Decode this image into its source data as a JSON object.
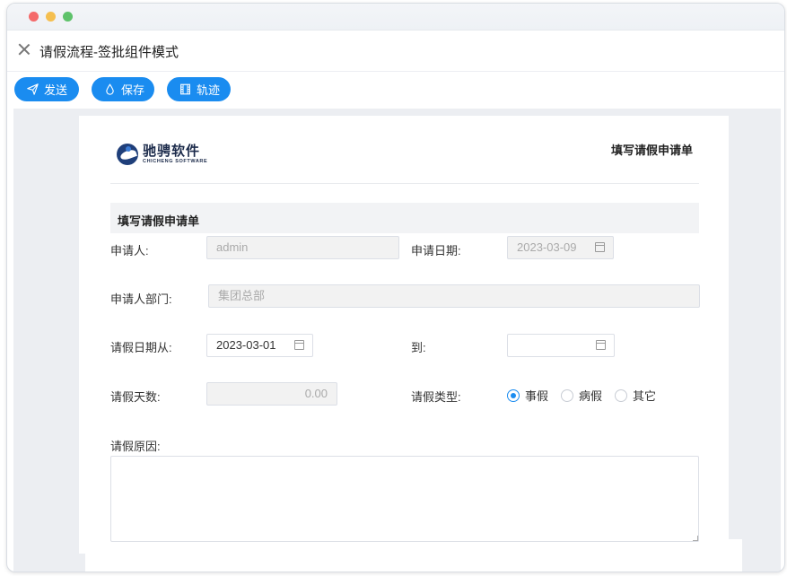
{
  "window": {
    "controls": [
      "close",
      "minimize",
      "maximize"
    ]
  },
  "header": {
    "title": "请假流程-签批组件模式"
  },
  "toolbar": {
    "send_label": "发送",
    "save_label": "保存",
    "track_label": "轨迹",
    "accent_color": "#1a8cf0"
  },
  "document": {
    "logo_cn": "驰骋软件",
    "logo_en": "CHICHENG SOFTWARE",
    "title": "填写请假申请单",
    "section_title": "填写请假申请单"
  },
  "form": {
    "applicant_label": "申请人:",
    "applicant_value": "admin",
    "apply_date_label": "申请日期:",
    "apply_date_value": "2023-03-09",
    "dept_label": "申请人部门:",
    "dept_value": "集团总部",
    "from_label": "请假日期从:",
    "from_value": "2023-03-01",
    "to_label": "到:",
    "to_value": "",
    "days_label": "请假天数:",
    "days_value": "0.00",
    "type_label": "请假类型:",
    "type_options": [
      "事假",
      "病假",
      "其它"
    ],
    "type_selected": "事假",
    "reason_label": "请假原因:",
    "reason_value": ""
  }
}
